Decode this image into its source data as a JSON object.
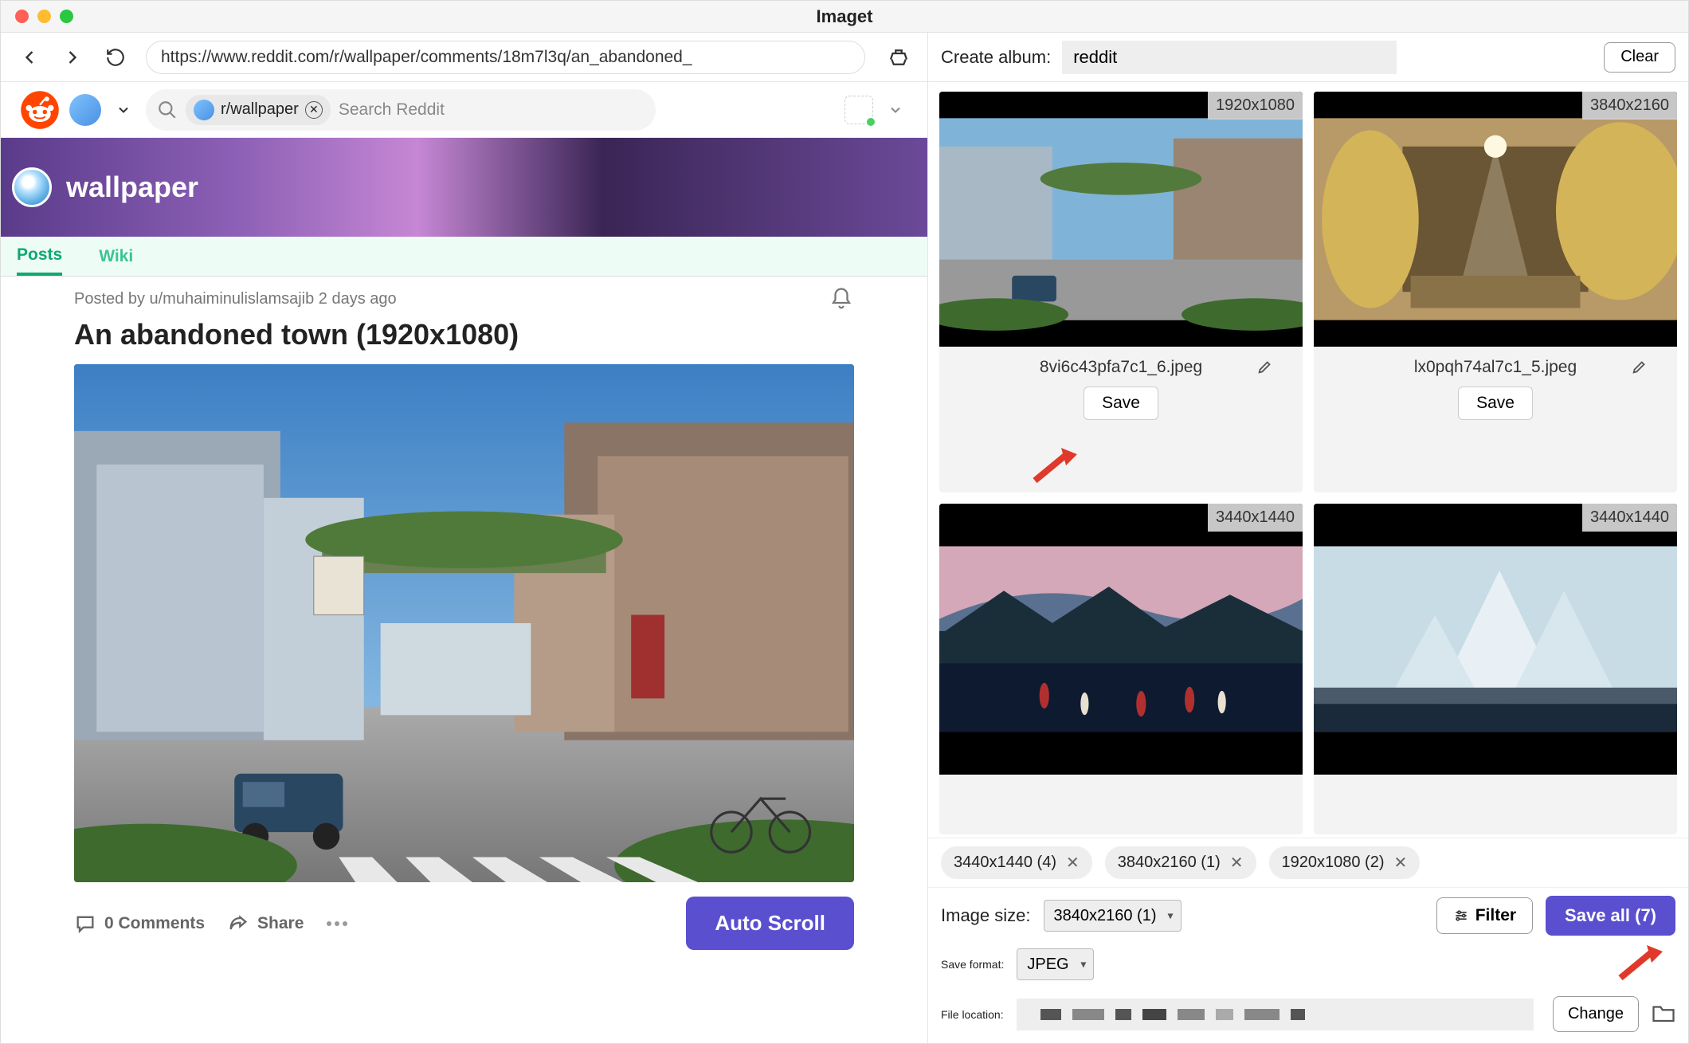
{
  "titlebar": {
    "title": "Imaget"
  },
  "nav": {
    "url": "https://www.reddit.com/r/wallpaper/comments/18m7l3q/an_abandoned_"
  },
  "reddit": {
    "subreddit_chip": "r/wallpaper",
    "search_placeholder": "Search Reddit",
    "banner_title": "wallpaper",
    "tabs": [
      "Posts",
      "Wiki"
    ],
    "active_tab": 0,
    "post_meta": "Posted by u/muhaiminulislamsajib 2 days ago",
    "post_title": "An abandoned town (1920x1080)",
    "comments_label": "0 Comments",
    "share_label": "Share",
    "autoscroll_label": "Auto Scroll"
  },
  "right": {
    "album_label": "Create album:",
    "album_value": "reddit",
    "clear_label": "Clear",
    "thumbs": [
      {
        "size": "1920x1080",
        "filename": "8vi6c43pfa7c1_6.jpeg",
        "save": "Save"
      },
      {
        "size": "3840x2160",
        "filename": "lx0pqh74al7c1_5.jpeg",
        "save": "Save"
      },
      {
        "size": "3440x1440"
      },
      {
        "size": "3440x1440"
      }
    ],
    "filters": [
      "3440x1440 (4)",
      "3840x2160 (1)",
      "1920x1080 (2)"
    ],
    "size_label": "Image size:",
    "size_select": "3840x2160 (1)",
    "filter_label": "Filter",
    "saveall_label": "Save all (7)",
    "format_label": "Save format:",
    "format_select": "JPEG",
    "location_label": "File location:",
    "change_label": "Change"
  }
}
